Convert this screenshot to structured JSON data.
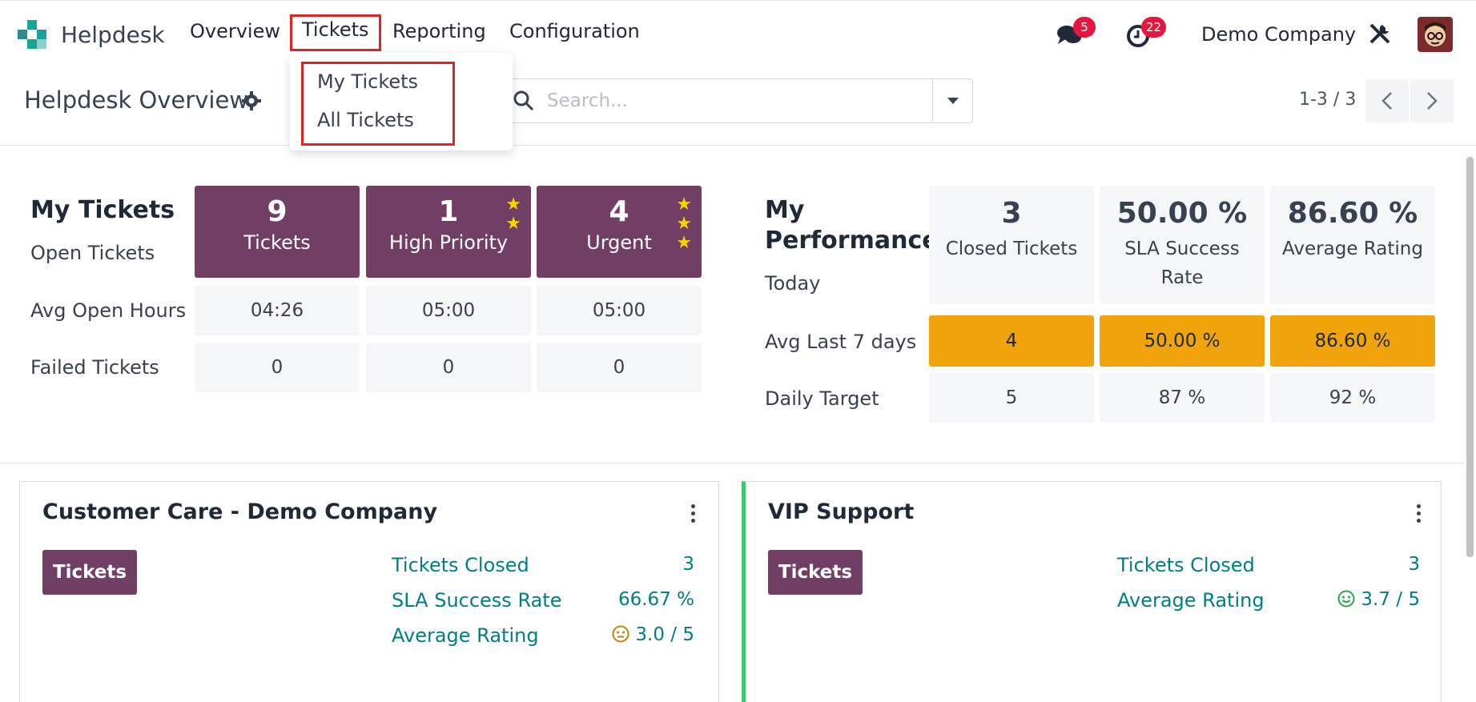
{
  "navbar": {
    "app_name": "Helpdesk",
    "menu": [
      "Overview",
      "Tickets",
      "Reporting",
      "Configuration"
    ],
    "messages_badge": "5",
    "activities_badge": "22",
    "company": "Demo Company"
  },
  "dropdown": {
    "items": [
      "My Tickets",
      "All Tickets"
    ]
  },
  "control": {
    "title": "Helpdesk Overview",
    "search_placeholder": "Search...",
    "pager": "1-3 / 3"
  },
  "my_tickets": {
    "heading": "My Tickets",
    "sub": "Open Tickets",
    "row_avg": "Avg Open Hours",
    "row_failed": "Failed Tickets",
    "cards": [
      {
        "num": "9",
        "label": "Tickets"
      },
      {
        "num": "1",
        "label": "High Priority"
      },
      {
        "num": "4",
        "label": "Urgent"
      }
    ],
    "avg_hours": [
      "04:26",
      "05:00",
      "05:00"
    ],
    "failed": [
      "0",
      "0",
      "0"
    ]
  },
  "performance": {
    "heading_1": "My",
    "heading_2": "Performance",
    "sub": "Today",
    "row_avg": "Avg Last 7 days",
    "row_target": "Daily Target",
    "cards": [
      {
        "num": "3",
        "label": "Closed Tickets"
      },
      {
        "num": "50.00 %",
        "label": "SLA Success Rate"
      },
      {
        "num": "86.60 %",
        "label": "Average Rating"
      }
    ],
    "avg7": [
      "4",
      "50.00 %",
      "86.60 %"
    ],
    "target": [
      "5",
      "87 %",
      "92 %"
    ]
  },
  "teams": [
    {
      "name": "Customer Care - Demo Company",
      "button": "Tickets",
      "stats": [
        {
          "label": "Tickets Closed",
          "value": "3"
        },
        {
          "label": "SLA Success Rate",
          "value": "66.67 %"
        },
        {
          "label": "Average Rating",
          "value": "3.0 / 5"
        }
      ]
    },
    {
      "name": "VIP Support",
      "button": "Tickets",
      "stats": [
        {
          "label": "Tickets Closed",
          "value": "3"
        },
        {
          "label": "Average Rating",
          "value": "3.7 / 5"
        }
      ]
    }
  ],
  "colors": {
    "brand_purple": "#713E65",
    "highlight_orange": "#F0A30A",
    "teal_link": "#017e84",
    "badge_red": "#e5173f",
    "annotation_red": "#e02424",
    "vip_accent": "#3cc86e"
  }
}
